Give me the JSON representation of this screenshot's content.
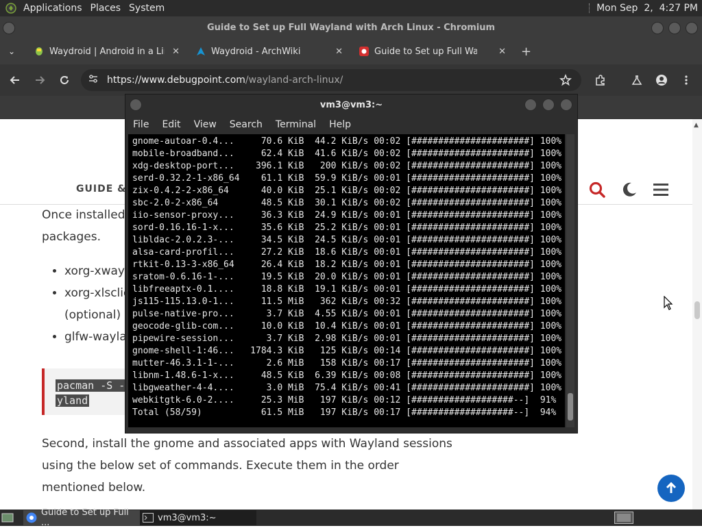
{
  "top_panel": {
    "menu": [
      "Applications",
      "Places",
      "System"
    ],
    "datetime": "Mon Sep  2,  4:27 PM"
  },
  "chromium": {
    "title": "Guide to Set up Full Wayland with Arch Linux - Chromium",
    "tabs": [
      {
        "label": "Waydroid | Android in a Linux container"
      },
      {
        "label": "Waydroid - ArchWiki"
      },
      {
        "label": "Guide to Set up Full Wayland with Arch Linux"
      }
    ],
    "url_host": "https://www.debugpoint.com",
    "url_path": "/wayland-arch-linux/"
  },
  "page": {
    "nav_label": "GUIDE &",
    "para1_line1": "Once installed,",
    "para1_line2": "packages.",
    "bullets": [
      "xorg-xwayla",
      "xorg-xlsclie",
      "(optional)",
      "glfw-waylar"
    ],
    "code_line1": "pacman -S -",
    "code_line2": "yland",
    "para2": [
      "Second, install the gnome and associated apps with Wayland sessions",
      "using the below set of commands. Execute them in the order",
      "mentioned below."
    ]
  },
  "terminal": {
    "title": "vm3@vm3:~",
    "menu": [
      "File",
      "Edit",
      "View",
      "Search",
      "Terminal",
      "Help"
    ],
    "lines": [
      "gnome-autoar-0.4...     70.6 KiB  44.2 KiB/s 00:02 [######################] 100%",
      "mobile-broadband...     62.4 KiB  41.6 KiB/s 00:02 [######################] 100%",
      "xdg-desktop-port...    396.1 KiB   200 KiB/s 00:02 [######################] 100%",
      "serd-0.32.2-1-x86_64    61.1 KiB  59.9 KiB/s 00:01 [######################] 100%",
      "zix-0.4.2-2-x86_64      40.0 KiB  25.1 KiB/s 00:02 [######################] 100%",
      "sbc-2.0-2-x86_64        48.5 KiB  30.1 KiB/s 00:02 [######################] 100%",
      "iio-sensor-proxy...     36.3 KiB  24.9 KiB/s 00:01 [######################] 100%",
      "sord-0.16.16-1-x...     35.6 KiB  25.2 KiB/s 00:01 [######################] 100%",
      "libldac-2.0.2.3-...     34.5 KiB  24.5 KiB/s 00:01 [######################] 100%",
      "alsa-card-profil...     27.2 KiB  18.6 KiB/s 00:01 [######################] 100%",
      "rtkit-0.13-3-x86_64     26.4 KiB  18.2 KiB/s 00:01 [######################] 100%",
      "sratom-0.6.16-1-...     19.5 KiB  20.0 KiB/s 00:01 [######################] 100%",
      "libfreeaptx-0.1....     18.8 KiB  19.1 KiB/s 00:01 [######################] 100%",
      "js115-115.13.0-1...     11.5 MiB   362 KiB/s 00:32 [######################] 100%",
      "pulse-native-pro...      3.7 KiB  4.55 KiB/s 00:01 [######################] 100%",
      "geocode-glib-com...     10.0 KiB  10.4 KiB/s 00:01 [######################] 100%",
      "pipewire-session...      3.7 KiB  2.98 KiB/s 00:01 [######################] 100%",
      "gnome-shell-1:46...   1784.3 KiB   125 KiB/s 00:14 [######################] 100%",
      "mutter-46.3.1-1-...      2.6 MiB   158 KiB/s 00:17 [######################] 100%",
      "libnm-1.48.6-1-x...     48.5 KiB  6.39 KiB/s 00:08 [######################] 100%",
      "libgweather-4-4....      3.0 MiB  75.4 KiB/s 00:41 [######################] 100%",
      "webkitgtk-6.0-2....     25.3 MiB   197 KiB/s 00:12 [###################--]  91%",
      "Total (58/59)           61.5 MiB   197 KiB/s 00:17 [###################--]  94%"
    ]
  },
  "taskbar": {
    "items": [
      {
        "label": "Guide to Set up Full ..."
      },
      {
        "label": "vm3@vm3:~"
      }
    ]
  },
  "colors": {
    "accent_red": "#c62828",
    "fab_blue": "#1565c0"
  }
}
